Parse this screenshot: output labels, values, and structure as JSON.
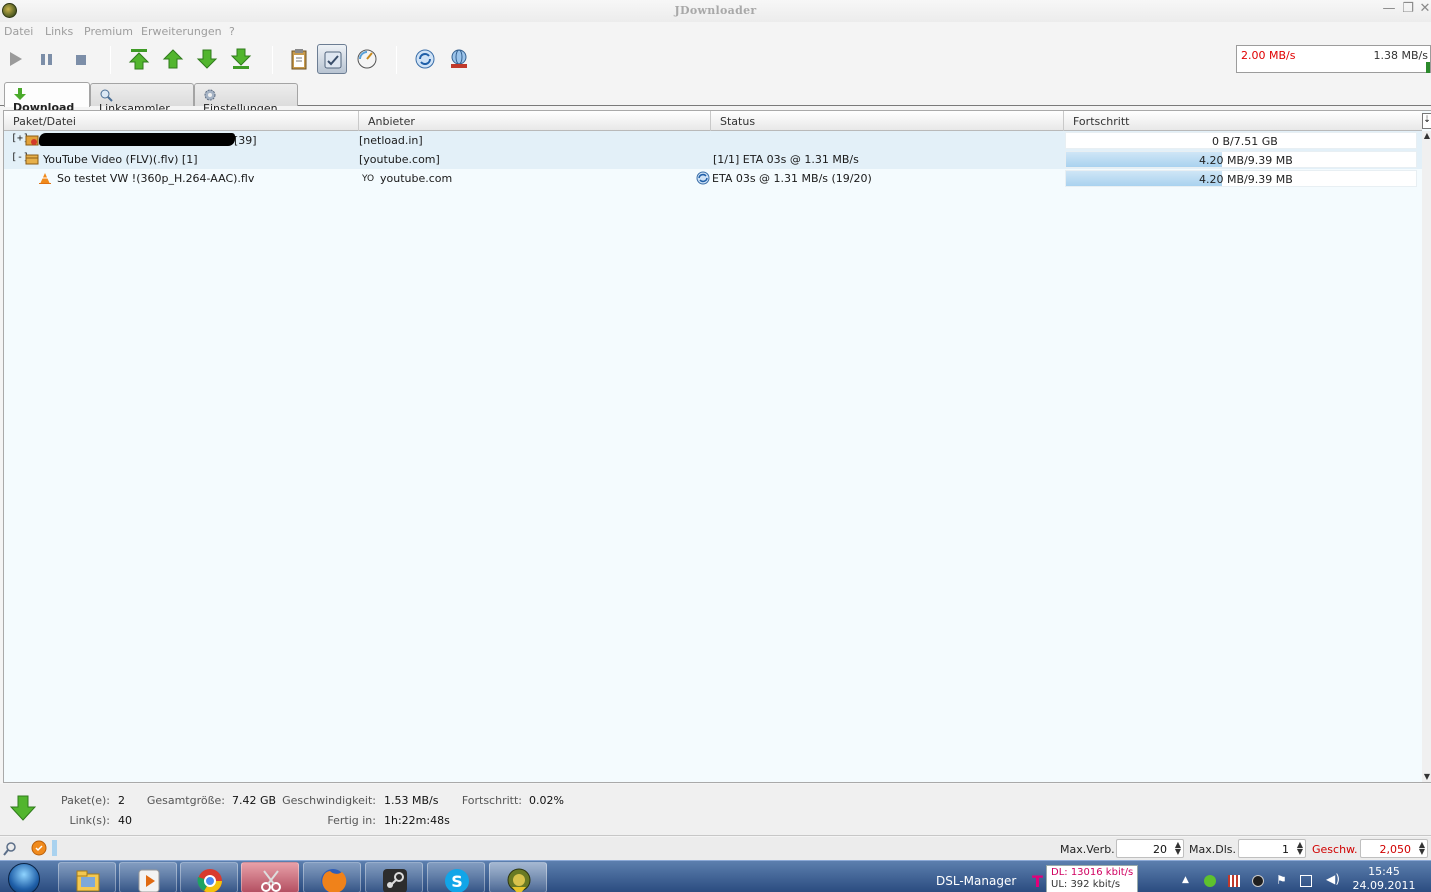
{
  "window": {
    "title": "JDownloader",
    "minimize": "—",
    "maximize": "❐",
    "close": "✕"
  },
  "menu": [
    "Datei",
    "Links",
    "Premium",
    "Erweiterungen",
    "?"
  ],
  "speed": {
    "limit": "2.00 MB/s",
    "current": "1.38 MB/s"
  },
  "tabs": [
    {
      "label": "Download",
      "icon": "download-arrow-icon"
    },
    {
      "label": "Linksammler",
      "icon": "magnifier-icon"
    },
    {
      "label": "Einstellungen",
      "icon": "gear-icon"
    }
  ],
  "columns": [
    "Paket/Datei",
    "Anbieter",
    "Status",
    "Fortschritt"
  ],
  "rows": [
    {
      "type": "package",
      "expander": "[+]",
      "name_suffix": "[39]",
      "hoster": "[netload.in]",
      "status": "",
      "progress_text": "0 B/7.51 GB",
      "progress_fraction": 0.0
    },
    {
      "type": "package",
      "expander": "[-]",
      "name": "YouTube Video (FLV)(.flv) [1]",
      "hoster": "[youtube.com]",
      "status": "[1/1] ETA 03s @ 1.31 MB/s",
      "progress_text": "4.20 MB/9.39 MB",
      "progress_fraction": 0.447
    },
    {
      "type": "file",
      "name": "So testet VW !(360p_H.264-AAC).flv",
      "hoster_icon": "YO",
      "hoster": "youtube.com",
      "status": "ETA 03s @ 1.31 MB/s (19/20)",
      "progress_text": "4.20 MB/9.39 MB",
      "progress_fraction": 0.447
    }
  ],
  "summary": {
    "packages_label": "Paket(e):",
    "packages": "2",
    "links_label": "Link(s):",
    "links": "40",
    "size_label": "Gesamtgröße:",
    "size": "7.42 GB",
    "speed_label": "Geschwindigkeit:",
    "speed": "1.53 MB/s",
    "eta_label": "Fertig in:",
    "eta": "1h:22m:48s",
    "progress_label": "Fortschritt:",
    "progress": "0.02%"
  },
  "statusbar": {
    "max_conn_label": "Max.Verb.",
    "max_conn": "20",
    "max_dls_label": "Max.Dls.",
    "max_dls": "1",
    "speed_label": "Geschw.",
    "speed": "2,050"
  },
  "taskbar": {
    "dsl_label": "DSL-Manager",
    "dsl_dl": "DL:  13016 kbit/s",
    "dsl_ul": "UL:    392 kbit/s",
    "time": "15:45",
    "date": "24.09.2011"
  },
  "colors": {
    "accent": "#a9d2ef",
    "package_row": "#e3f0f8",
    "limit_red": "#e00000",
    "taskbar": "#2b4c80"
  }
}
